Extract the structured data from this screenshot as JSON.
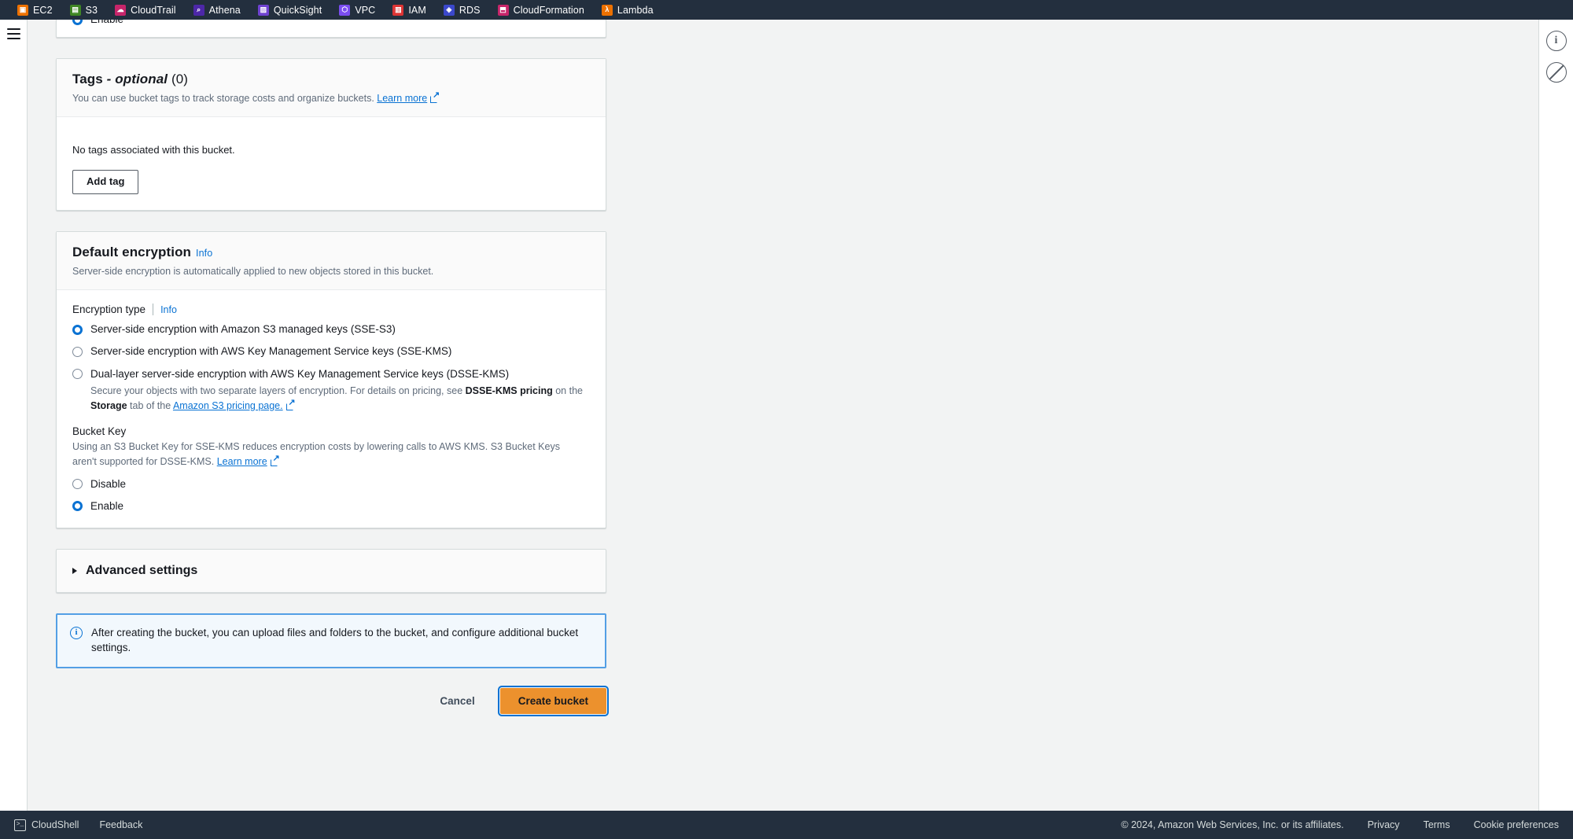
{
  "topnav": {
    "services": [
      {
        "label": "EC2",
        "icon": "ec2-icon",
        "color": "#ed7100",
        "glyph": "▣"
      },
      {
        "label": "S3",
        "icon": "s3-icon",
        "color": "#3f8624",
        "glyph": "▤"
      },
      {
        "label": "CloudTrail",
        "icon": "cloudtrail-icon",
        "color": "#c7256a",
        "glyph": "☁"
      },
      {
        "label": "Athena",
        "icon": "athena-icon",
        "color": "#4d27a8",
        "glyph": "⌕"
      },
      {
        "label": "QuickSight",
        "icon": "quicksight-icon",
        "color": "#6f42d1",
        "glyph": "▨"
      },
      {
        "label": "VPC",
        "icon": "vpc-icon",
        "color": "#7a4df0",
        "glyph": "⬡"
      },
      {
        "label": "IAM",
        "icon": "iam-icon",
        "color": "#dd3434",
        "glyph": "▥"
      },
      {
        "label": "RDS",
        "icon": "rds-icon",
        "color": "#3b48cc",
        "glyph": "◈"
      },
      {
        "label": "CloudFormation",
        "icon": "cloudformation-icon",
        "color": "#c7256a",
        "glyph": "⬒"
      },
      {
        "label": "Lambda",
        "icon": "lambda-icon",
        "color": "#ed7100",
        "glyph": "λ"
      }
    ]
  },
  "rightrail": {
    "info_icon": "info-icon",
    "info_glyph": "i",
    "notifications_icon": "no-entry-icon"
  },
  "partial_card": {
    "label": "Enable",
    "selected": true
  },
  "tags": {
    "title": "Tags",
    "optional": " - optional",
    "count": " (0)",
    "description": "You can use bucket tags to track storage costs and organize buckets.",
    "learn_more": "Learn more",
    "empty_message": "No tags associated with this bucket.",
    "add_tag_label": "Add tag"
  },
  "encryption": {
    "title": "Default encryption",
    "info": "Info",
    "description": "Server-side encryption is automatically applied to new objects stored in this bucket.",
    "type_label": "Encryption type",
    "type_info": "Info",
    "options": [
      {
        "label": "Server-side encryption with Amazon S3 managed keys (SSE-S3)",
        "selected": true
      },
      {
        "label": "Server-side encryption with AWS Key Management Service keys (SSE-KMS)",
        "selected": false
      },
      {
        "label": "Dual-layer server-side encryption with AWS Key Management Service keys (DSSE-KMS)",
        "selected": false
      }
    ],
    "dsse_desc_a": "Secure your objects with two separate layers of encryption. For details on pricing, see ",
    "dsse_desc_b": "DSSE-KMS pricing",
    "dsse_desc_c": " on the ",
    "dsse_desc_d": "Storage",
    "dsse_desc_e": " tab of the ",
    "dsse_link": "Amazon S3 pricing page.",
    "bucket_key_label": "Bucket Key",
    "bucket_key_desc_a": "Using an S3 Bucket Key for SSE-KMS reduces encryption costs by lowering calls to AWS KMS. S3 Bucket Keys aren't supported for DSSE-KMS. ",
    "bucket_key_learn_more": "Learn more",
    "bucket_key_options": [
      {
        "label": "Disable",
        "selected": false
      },
      {
        "label": "Enable",
        "selected": true
      }
    ]
  },
  "advanced": {
    "label": "Advanced settings"
  },
  "alert": {
    "message": "After creating the bucket, you can upload files and folders to the bucket, and configure additional bucket settings."
  },
  "actions": {
    "cancel": "Cancel",
    "create": "Create bucket"
  },
  "footer": {
    "cloudshell": "CloudShell",
    "feedback": "Feedback",
    "copyright": "© 2024, Amazon Web Services, Inc. or its affiliates.",
    "privacy": "Privacy",
    "terms": "Terms",
    "cookies": "Cookie preferences"
  },
  "colors": {
    "accent_blue": "#0972d3",
    "primary_orange": "#ec912d",
    "nav_dark": "#232f3e",
    "page_bg": "#f2f3f3"
  }
}
